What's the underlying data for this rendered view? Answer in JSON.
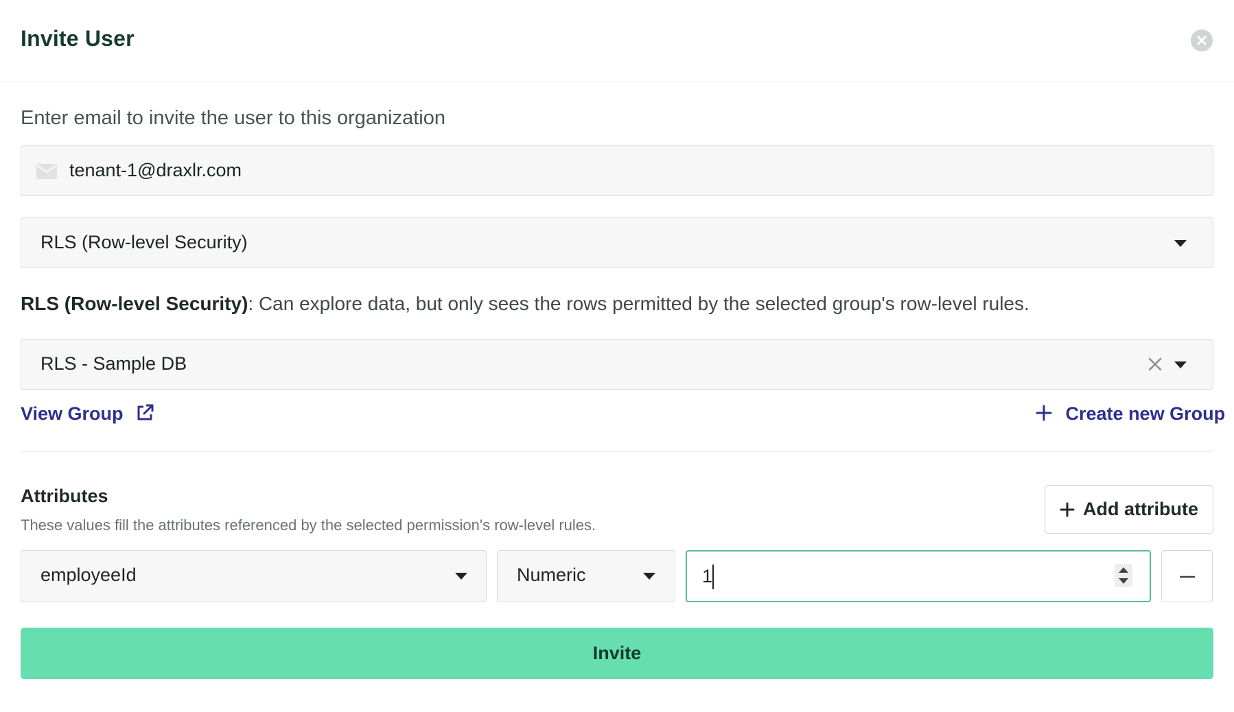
{
  "dialog": {
    "title": "Invite User"
  },
  "form": {
    "instructions": "Enter email to invite the user to this organization",
    "email_value": "tenant-1@draxlr.com",
    "role_selected": "RLS (Row-level Security)",
    "role_description_name": "RLS (Row-level Security)",
    "role_description_text": ": Can explore data, but only sees the rows permitted by the selected group's row-level rules.",
    "group_selected": "RLS - Sample DB",
    "view_group_label": "View Group",
    "create_group_label": "Create new Group"
  },
  "attributes": {
    "heading": "Attributes",
    "help_text": "These values fill the attributes referenced by the selected permission's row-level rules.",
    "add_label": "Add attribute",
    "rows": [
      {
        "name": "employeeId",
        "type": "Numeric",
        "value": "1"
      }
    ]
  },
  "actions": {
    "invite_label": "Invite"
  },
  "colors": {
    "primary_button": "#67deb0",
    "link": "#2e2f8f",
    "focus_border": "#5bbf8d",
    "title": "#173a2f"
  }
}
